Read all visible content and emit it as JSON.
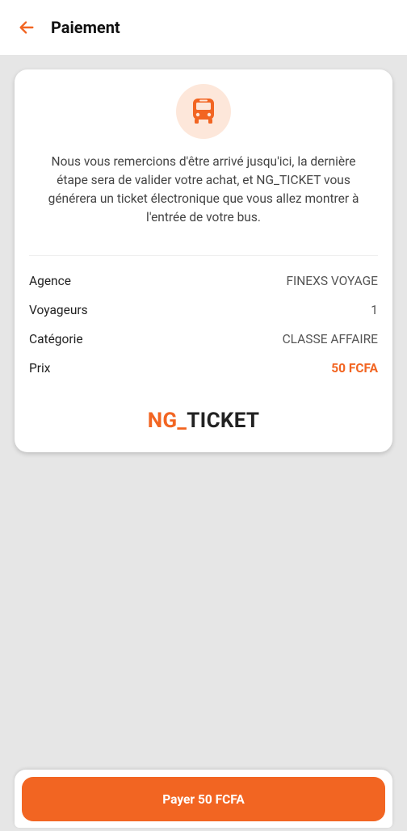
{
  "header": {
    "title": "Paiement",
    "back_icon": "arrow-left-icon",
    "accent": "#f26522"
  },
  "card": {
    "icon": "bus-icon",
    "message": "Nous vous remercions d'être arrivé jusqu'ici, la dernière étape sera de valider votre achat, et NG_TICKET vous générera un ticket électronique que vous allez montrer à l'entrée de votre bus.",
    "details": {
      "agency_label": "Agence",
      "agency_value": "FINEXS VOYAGE",
      "travelers_label": "Voyageurs",
      "travelers_value": "1",
      "category_label": "Catégorie",
      "category_value": "CLASSE AFFAIRE",
      "price_label": "Prix",
      "price_value": "50 FCFA"
    },
    "brand": {
      "part1": "NG_",
      "part2": "TICKET"
    }
  },
  "footer": {
    "pay_button_label": "Payer 50 FCFA"
  }
}
